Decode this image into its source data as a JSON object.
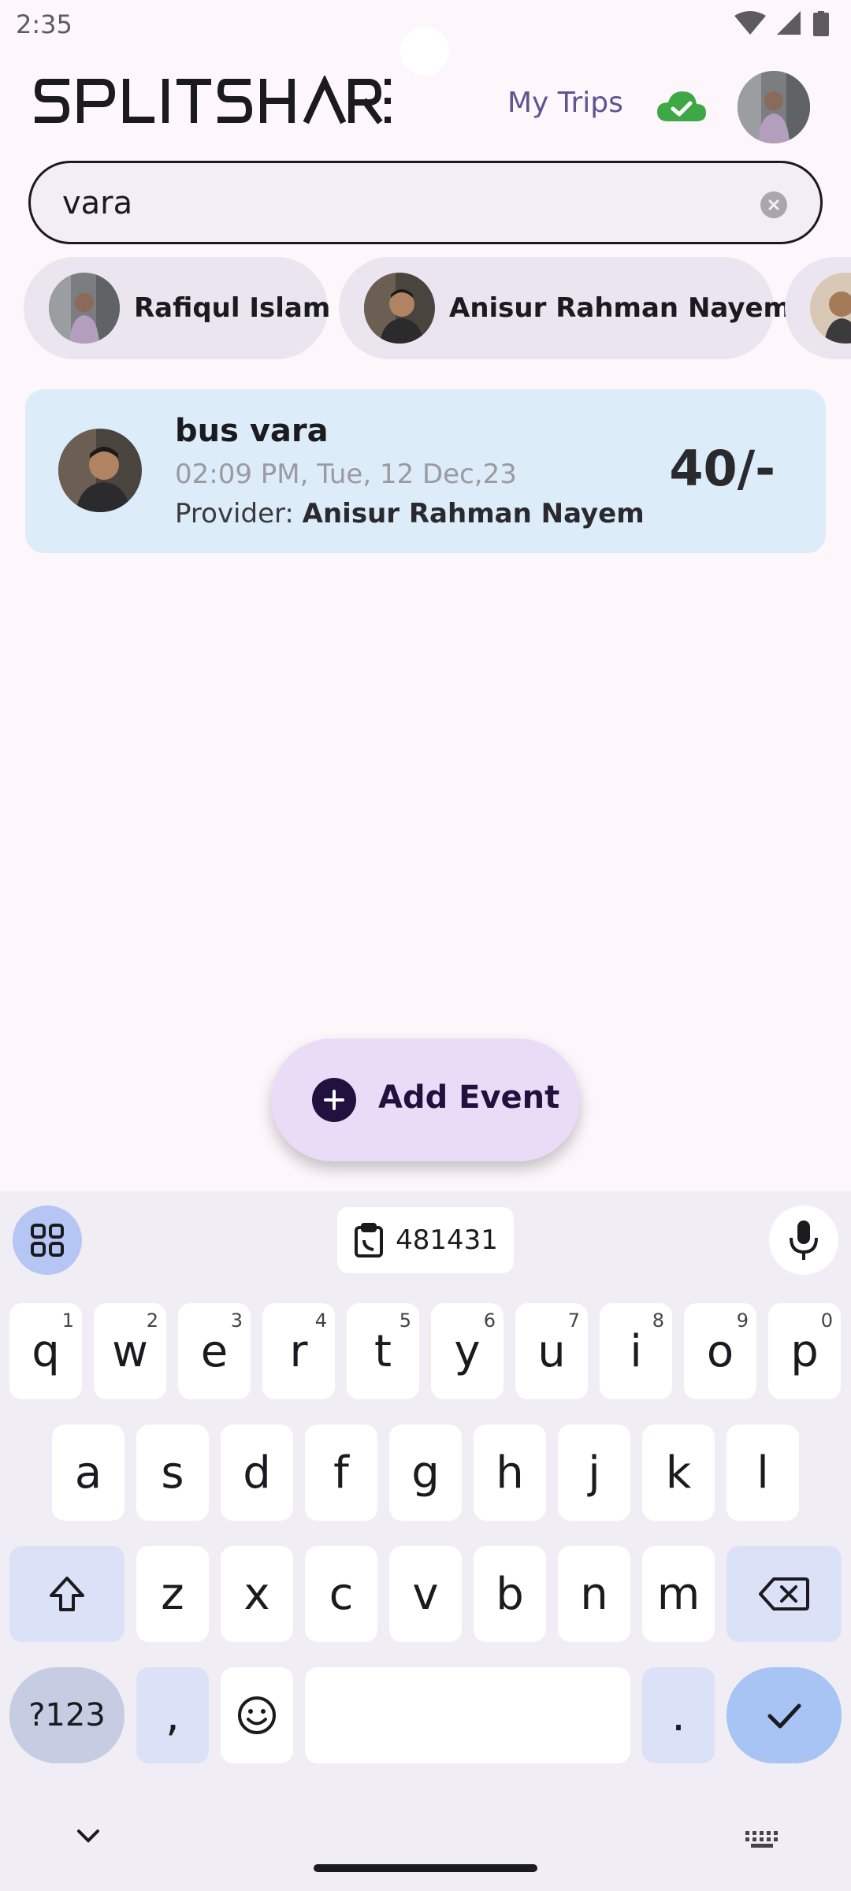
{
  "status_bar": {
    "time": "2:35"
  },
  "header": {
    "logo_text": "SPLITSHARE",
    "my_trips_label": "My Trips",
    "sync_icon": "cloud-check-icon",
    "accent_color": "#5d5490",
    "cloud_color": "#3ea846"
  },
  "search": {
    "value": "vara",
    "placeholder": ""
  },
  "people_chips": [
    {
      "name": "Rafiqul Islam"
    },
    {
      "name": "Anisur Rahman Nayem"
    },
    {
      "name": ""
    }
  ],
  "expenses": [
    {
      "title": "bus vara",
      "datetime": "02:09 PM, Tue, 12 Dec,23",
      "provider_label": "Provider:",
      "provider_name": "Anisur Rahman Nayem",
      "amount": "40/-"
    }
  ],
  "fab": {
    "label": "Add Event"
  },
  "keyboard": {
    "clipboard_text": "481431",
    "row1": [
      {
        "k": "q",
        "h": "1"
      },
      {
        "k": "w",
        "h": "2"
      },
      {
        "k": "e",
        "h": "3"
      },
      {
        "k": "r",
        "h": "4"
      },
      {
        "k": "t",
        "h": "5"
      },
      {
        "k": "y",
        "h": "6"
      },
      {
        "k": "u",
        "h": "7"
      },
      {
        "k": "i",
        "h": "8"
      },
      {
        "k": "o",
        "h": "9"
      },
      {
        "k": "p",
        "h": "0"
      }
    ],
    "row2": [
      "a",
      "s",
      "d",
      "f",
      "g",
      "h",
      "j",
      "k",
      "l"
    ],
    "row3": [
      "z",
      "x",
      "c",
      "v",
      "b",
      "n",
      "m"
    ],
    "symbols_label": "?123",
    "comma_label": ",",
    "period_label": "."
  }
}
